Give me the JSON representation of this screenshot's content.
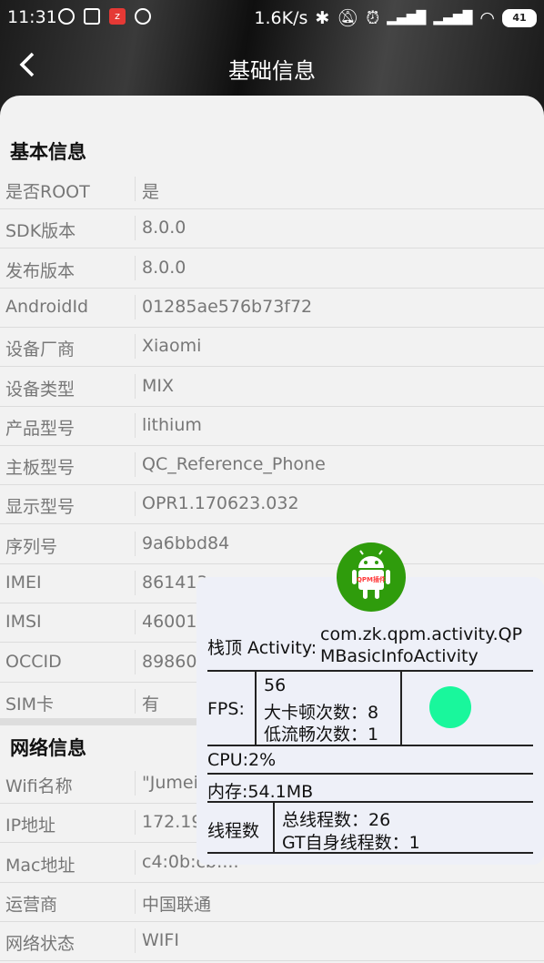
{
  "status_bar": {
    "time": "11:31",
    "network_speed": "1.6K/s",
    "battery": "41"
  },
  "nav": {
    "title": "基础信息"
  },
  "basic_section": {
    "title": "基本信息",
    "rows": [
      {
        "key": "是否ROOT",
        "value": "是"
      },
      {
        "key": "SDK版本",
        "value": "8.0.0"
      },
      {
        "key": "发布版本",
        "value": "8.0.0"
      },
      {
        "key": "AndroidId",
        "value": "01285ae576b73f72"
      },
      {
        "key": "设备厂商",
        "value": "Xiaomi"
      },
      {
        "key": "设备类型",
        "value": "MIX"
      },
      {
        "key": "产品型号",
        "value": "lithium"
      },
      {
        "key": "主板型号",
        "value": "QC_Reference_Phone"
      },
      {
        "key": "显示型号",
        "value": "OPR1.170623.032"
      },
      {
        "key": "序列号",
        "value": "9a6bbd84"
      },
      {
        "key": "IMEI",
        "value": "861413"
      },
      {
        "key": "IMSI",
        "value": "460012"
      },
      {
        "key": "OCCID",
        "value": "898601"
      },
      {
        "key": "SIM卡",
        "value": "有"
      }
    ]
  },
  "network_section": {
    "title": "网络信息",
    "rows": [
      {
        "key": "Wifi名称",
        "value": "\"Jumei"
      },
      {
        "key": "IP地址",
        "value": "172.19"
      },
      {
        "key": "Mac地址",
        "value": "c4:0b:cb:..."
      },
      {
        "key": "运营商",
        "value": "中国联通"
      },
      {
        "key": "网络状态",
        "value": "WIFI"
      }
    ]
  },
  "overlay": {
    "badge_label": "QPM插件",
    "activity_label": "栈顶 Activity:",
    "activity_value_line1": "com.zk.qpm.activity.QP",
    "activity_value_line2": "MBasicInfoActivity",
    "fps_label": "FPS:",
    "fps_value": "56",
    "big_jank": "大卡顿次数：8",
    "low_smooth": "低流畅次数：1",
    "cpu": "CPU:2%",
    "memory": "内存:54.1MB",
    "thread_label": "线程数",
    "total_threads": "总线程数：26",
    "gt_threads": "GT自身线程数：1",
    "status_color": "#19f79c"
  }
}
